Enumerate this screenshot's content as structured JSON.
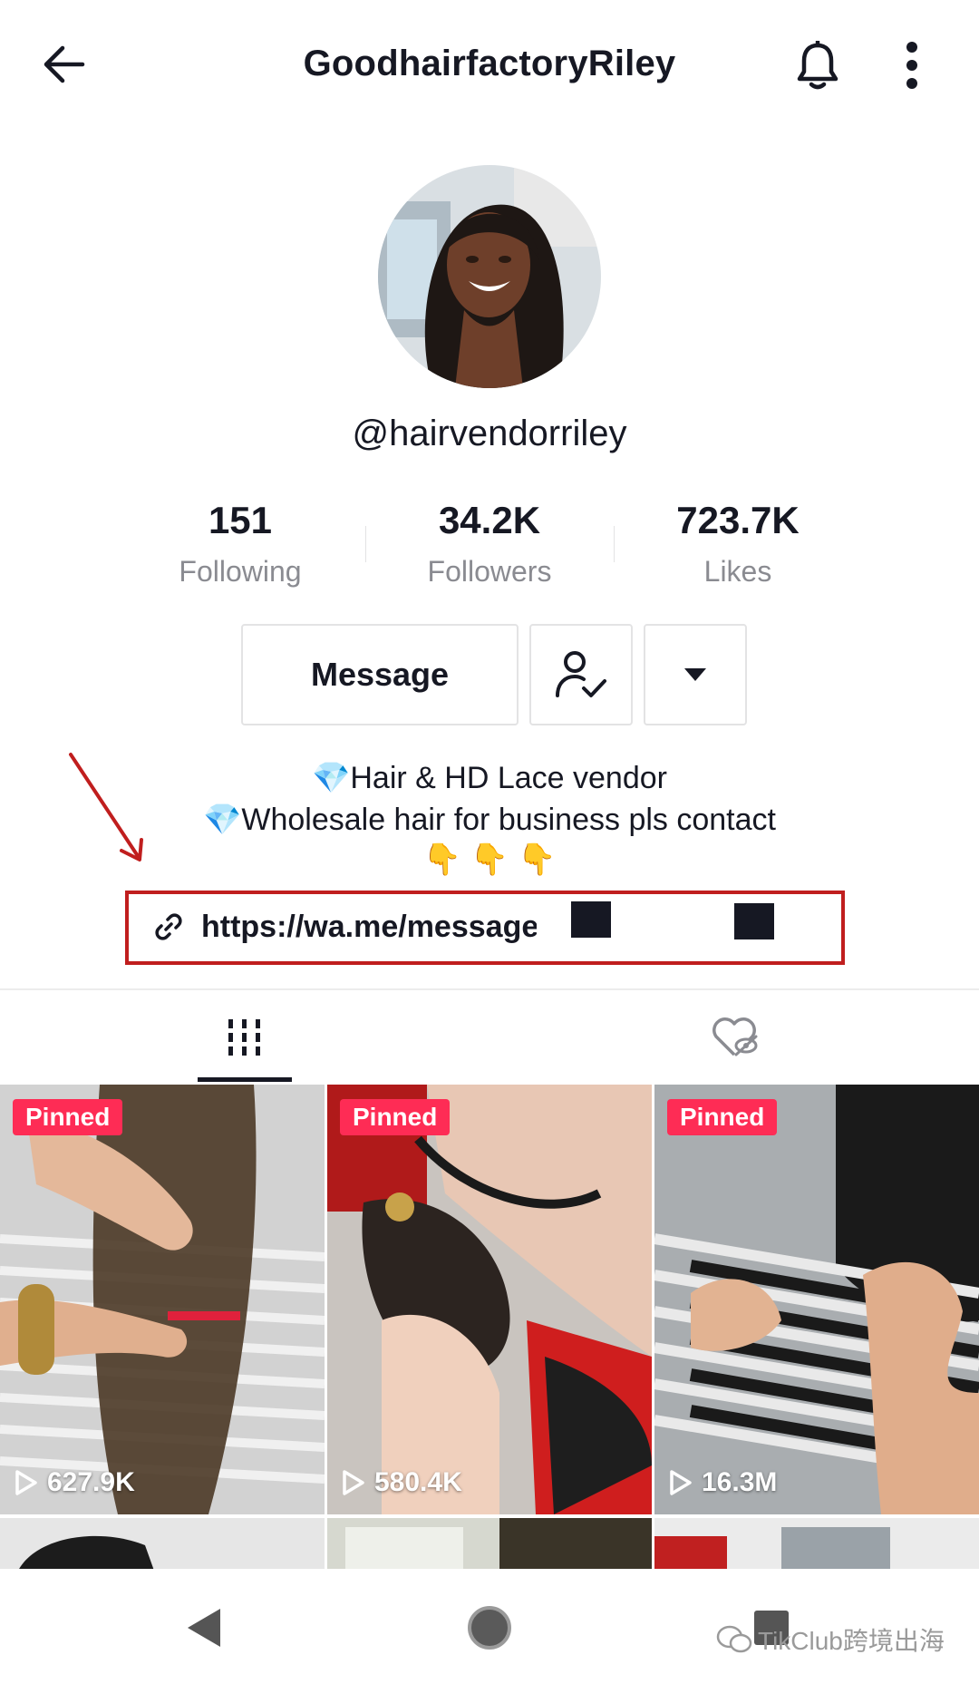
{
  "header": {
    "title": "GoodhairfactoryRiley",
    "back_icon": "arrow-left-icon",
    "bell_icon": "bell-icon",
    "more_icon": "vertical-dots-icon"
  },
  "profile": {
    "handle": "@hairvendorriley",
    "stats": [
      {
        "value": "151",
        "label": "Following"
      },
      {
        "value": "34.2K",
        "label": "Followers"
      },
      {
        "value": "723.7K",
        "label": "Likes"
      }
    ],
    "buttons": {
      "message": "Message",
      "follow_icon": "user-check-icon",
      "dropdown_icon": "caret-down-icon"
    },
    "bio": {
      "line1_emoji": "💎",
      "line1": "Hair & HD Lace vendor",
      "line2_emoji": "💎",
      "line2": "Wholesale hair for business pls contact",
      "line3": [
        "👇",
        "👇",
        "👇"
      ]
    },
    "link": {
      "icon": "link-icon",
      "text": "https://wa.me/message"
    }
  },
  "tabs": [
    {
      "name": "videos",
      "icon": "grid-columns-icon",
      "active": true
    },
    {
      "name": "liked",
      "icon": "heart-hidden-icon",
      "active": false
    }
  ],
  "videos": [
    {
      "pinned_label": "Pinned",
      "views": "627.9K"
    },
    {
      "pinned_label": "Pinned",
      "views": "580.4K"
    },
    {
      "pinned_label": "Pinned",
      "views": "16.3M"
    }
  ],
  "navbar": {
    "back_icon": "triangle-back-icon",
    "home_icon": "circle-home-icon",
    "recents_icon": "square-recents-icon"
  },
  "watermark": "TikClub跨境出海",
  "colors": {
    "pinned": "#fe2c55",
    "annotation": "#c01e1e",
    "text": "#161823",
    "secondary_text": "#8a8b91"
  }
}
